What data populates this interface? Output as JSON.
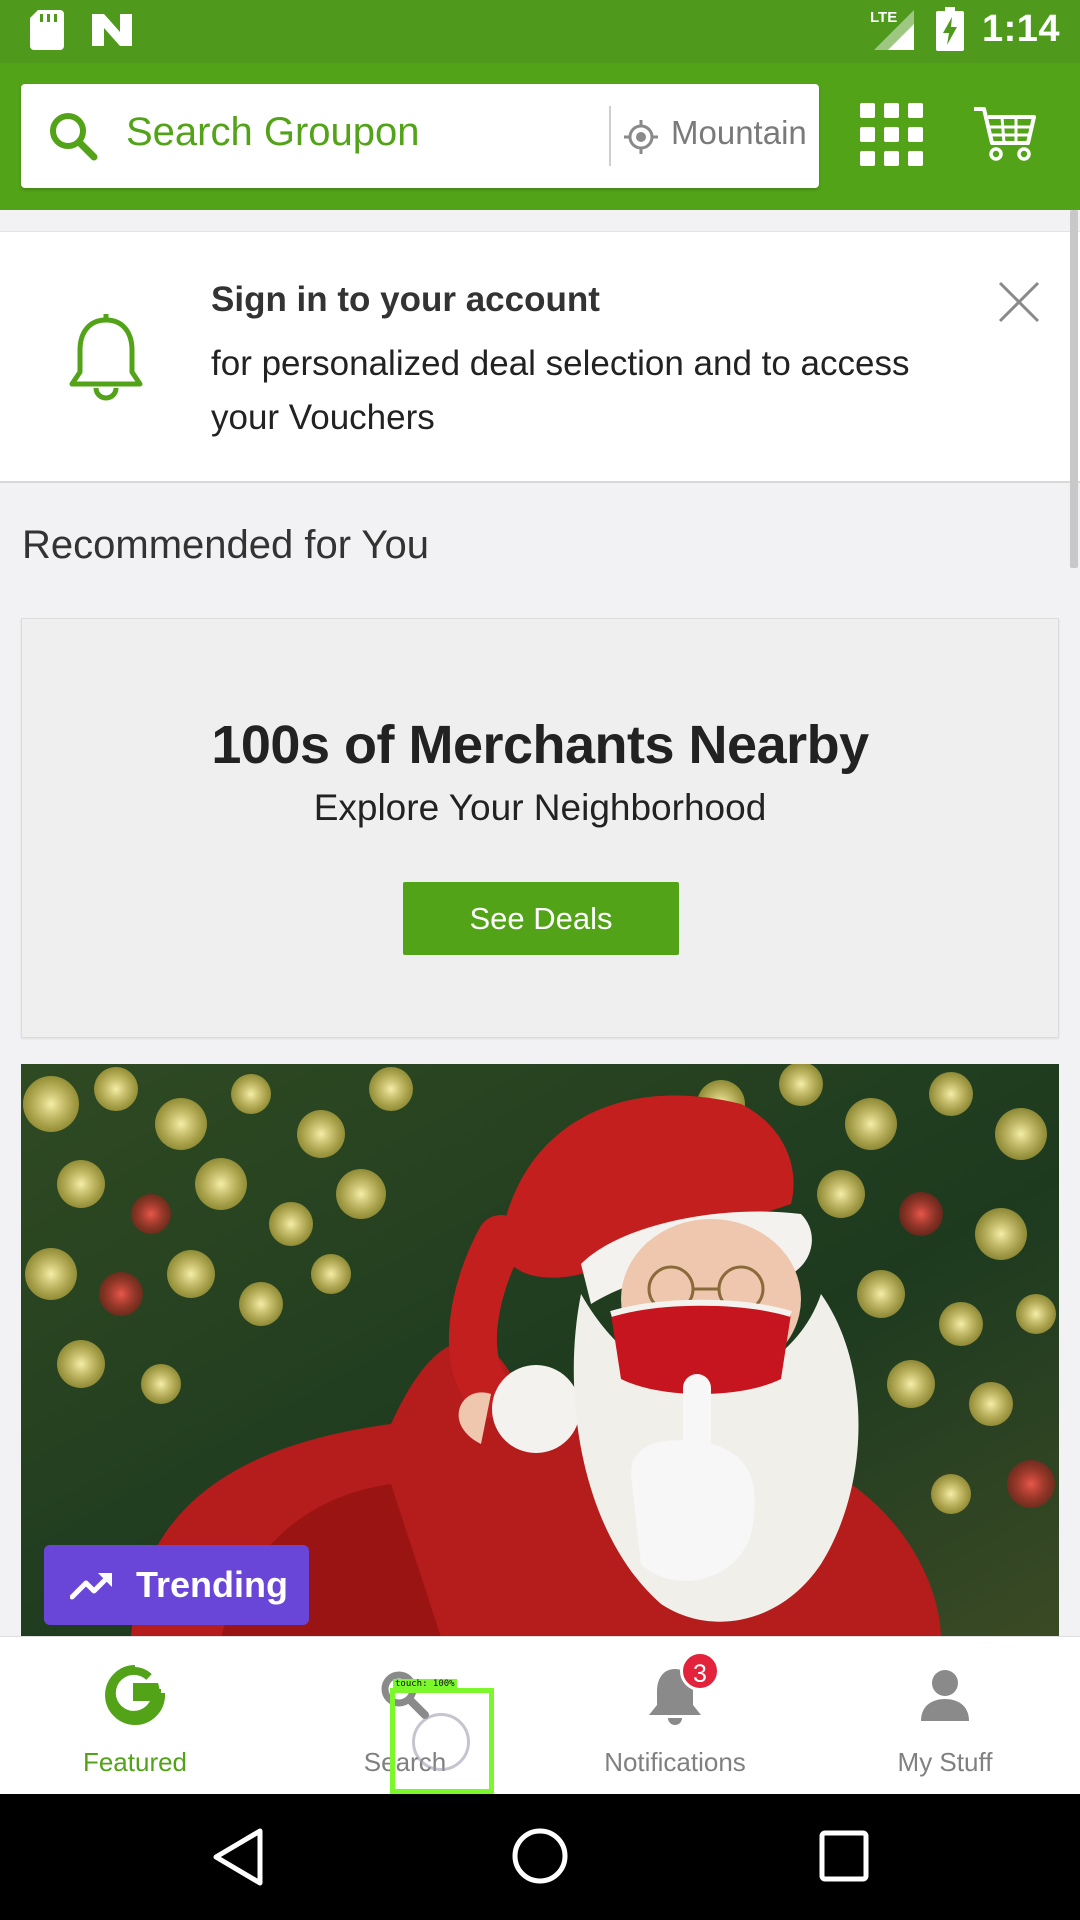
{
  "status_bar": {
    "time": "1:14",
    "network": "LTE",
    "icons": [
      "sd-card-icon",
      "n-app-icon",
      "signal-icon",
      "battery-charging-icon"
    ]
  },
  "header": {
    "search_placeholder": "Search Groupon",
    "location": "Mountain",
    "icons": [
      "search-icon",
      "location-icon",
      "grid-menu-icon",
      "cart-icon"
    ]
  },
  "signin_banner": {
    "title": "Sign in to your account",
    "body": "for personalized deal selection and to access your Vouchers",
    "icons": [
      "bell-icon",
      "close-icon"
    ]
  },
  "section_title": "Recommended for You",
  "merchants_card": {
    "title": "100s of Merchants Nearby",
    "subtitle": "Explore Your Neighborhood",
    "button": "See Deals"
  },
  "promo": {
    "badge": "Trending",
    "image": "santa-photo"
  },
  "bottom_nav": {
    "items": [
      {
        "label": "Featured",
        "icon": "groupon-g-icon",
        "active": true
      },
      {
        "label": "Search",
        "icon": "search-icon",
        "active": false
      },
      {
        "label": "Notifications",
        "icon": "bell-icon",
        "active": false,
        "badge": "3"
      },
      {
        "label": "My Stuff",
        "icon": "person-icon",
        "active": false
      }
    ]
  },
  "touch_indicator": "touch: 100%",
  "colors": {
    "brand_green": "#53a318",
    "status_green": "#4f9a1d",
    "trending_purple": "#6a46d8",
    "badge_red": "#e3223c"
  }
}
